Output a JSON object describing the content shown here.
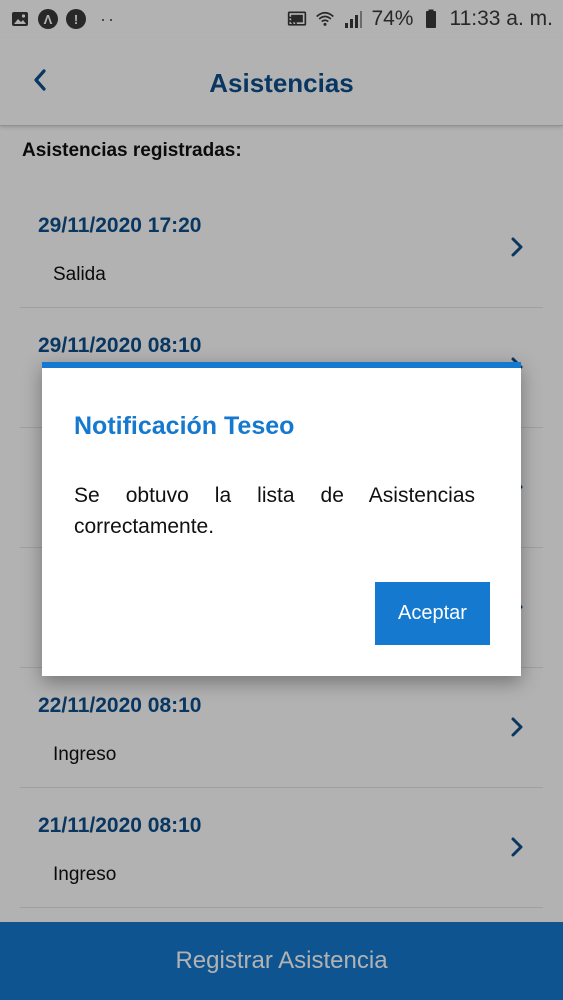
{
  "status_bar": {
    "battery": "74%",
    "time": "11:33 a. m.",
    "dots": "··"
  },
  "header": {
    "title": "Asistencias"
  },
  "section_label": "Asistencias registradas:",
  "records": [
    {
      "datetime": "29/11/2020 17:20",
      "type": "Salida"
    },
    {
      "datetime": "29/11/2020 08:10",
      "type": ""
    },
    {
      "datetime": "",
      "type": ""
    },
    {
      "datetime": "",
      "type": ""
    },
    {
      "datetime": "22/11/2020 08:10",
      "type": "Ingreso"
    },
    {
      "datetime": "21/11/2020 08:10",
      "type": "Ingreso"
    }
  ],
  "bottom_button": {
    "label": "Registrar Asistencia"
  },
  "dialog": {
    "title": "Notificación Teseo",
    "message": "Se obtuvo la lista de Asistencias correctamente.",
    "accept_label": "Aceptar"
  },
  "colors": {
    "primary": "#1479cf",
    "header_text": "#0d4f8b"
  },
  "icons": {
    "back": "chevron-left-icon",
    "row": "chevron-right-icon"
  }
}
